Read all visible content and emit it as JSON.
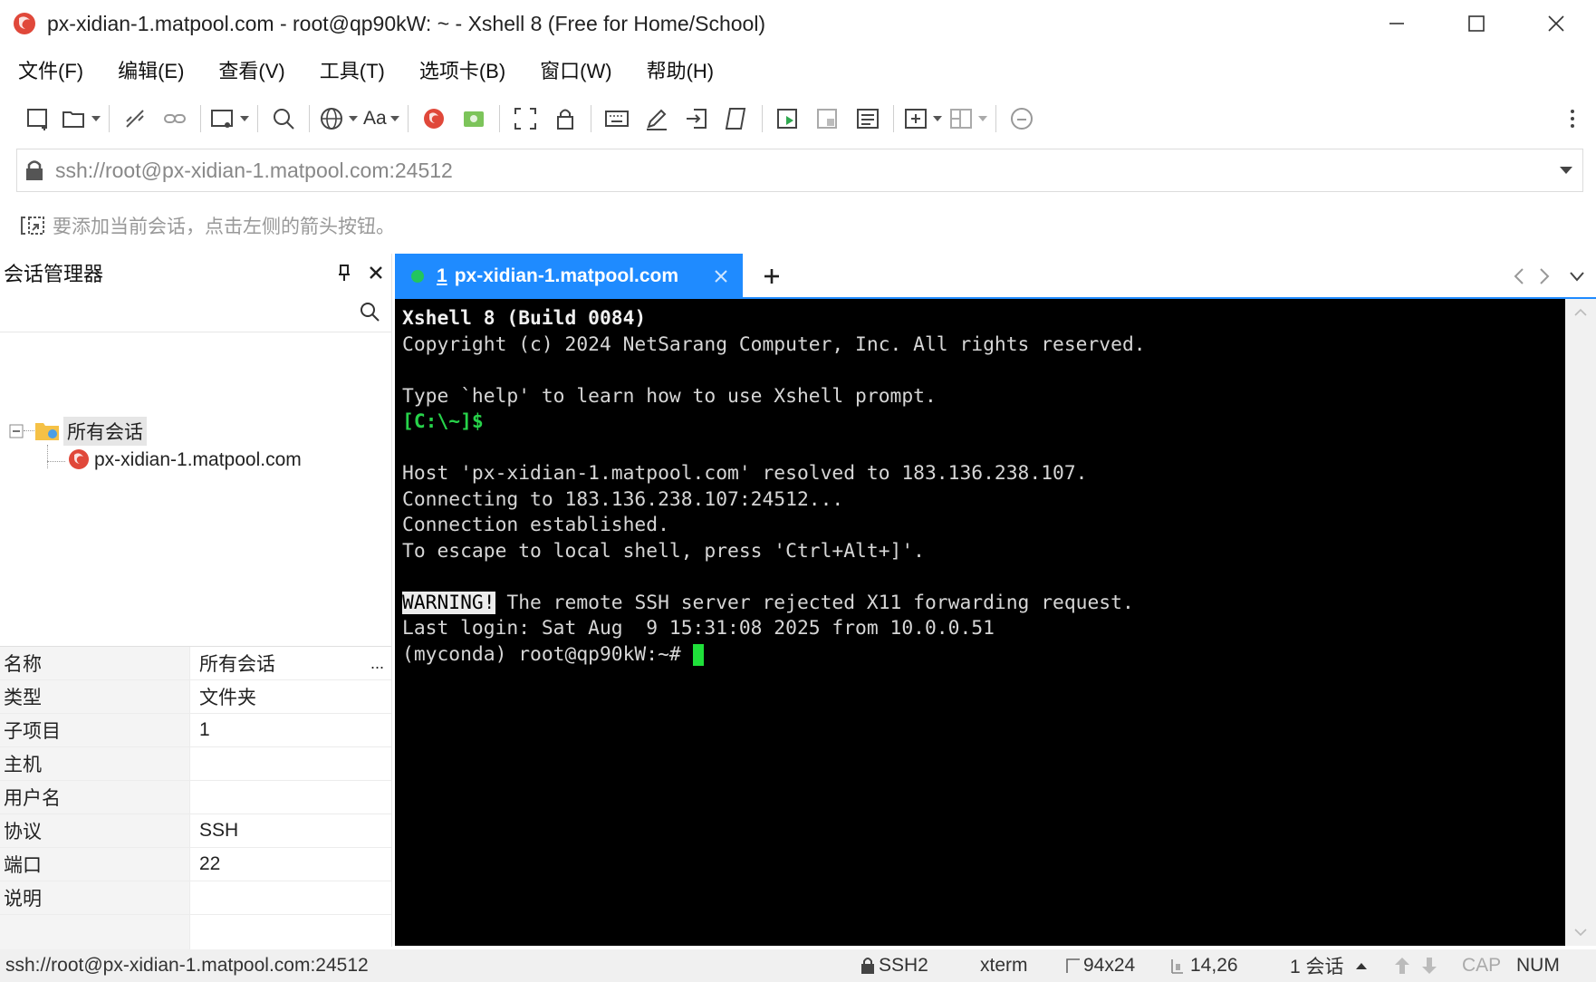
{
  "window": {
    "title": "px-xidian-1.matpool.com - root@qp90kW: ~ - Xshell 8 (Free for Home/School)"
  },
  "menu": [
    "文件(F)",
    "编辑(E)",
    "查看(V)",
    "工具(T)",
    "选项卡(B)",
    "窗口(W)",
    "帮助(H)"
  ],
  "address": {
    "value": "ssh://root@px-xidian-1.matpool.com:24512"
  },
  "hint": {
    "text": "要添加当前会话，点击左侧的箭头按钮。"
  },
  "toolbar": {
    "font_label": "Aa"
  },
  "session_manager": {
    "title": "会话管理器",
    "tree": {
      "root_label": "所有会话",
      "child_label": "px-xidian-1.matpool.com"
    },
    "properties": [
      {
        "key": "名称",
        "value": "所有会话"
      },
      {
        "key": "类型",
        "value": "文件夹"
      },
      {
        "key": "子项目",
        "value": "1"
      },
      {
        "key": "主机",
        "value": ""
      },
      {
        "key": "用户名",
        "value": ""
      },
      {
        "key": "协议",
        "value": "SSH"
      },
      {
        "key": "端口",
        "value": "22"
      },
      {
        "key": "说明",
        "value": ""
      }
    ],
    "more_label": "..."
  },
  "tabs": [
    {
      "number": "1",
      "label": "px-xidian-1.matpool.com",
      "status_color": "#22c55e"
    }
  ],
  "terminal": {
    "lines": [
      {
        "text": "Xshell 8 (Build 0084)",
        "style": "bold"
      },
      {
        "text": "Copyright (c) 2024 NetSarang Computer, Inc. All rights reserved."
      },
      {
        "text": ""
      },
      {
        "text": "Type `help' to learn how to use Xshell prompt."
      },
      {
        "text": "[C:\\~]$",
        "style": "green"
      },
      {
        "text": ""
      },
      {
        "text": "Host 'px-xidian-1.matpool.com' resolved to 183.136.238.107."
      },
      {
        "text": "Connecting to 183.136.238.107:24512..."
      },
      {
        "text": "Connection established."
      },
      {
        "text": "To escape to local shell, press 'Ctrl+Alt+]'."
      },
      {
        "text": ""
      },
      {
        "warning": "WARNING!",
        "text": " The remote SSH server rejected X11 forwarding request."
      },
      {
        "text": "Last login: Sat Aug  9 15:31:08 2025 from 10.0.0.51"
      },
      {
        "text": "(myconda) root@qp90kW:~# ",
        "cursor": true
      }
    ]
  },
  "status": {
    "address": "ssh://root@px-xidian-1.matpool.com:24512",
    "protocol": "SSH2",
    "terminal_type": "xterm",
    "size": "94x24",
    "cursor_pos": "14,26",
    "sessions": "1 会话",
    "cap": "CAP",
    "num": "NUM"
  },
  "colors": {
    "tab_active": "#1f8bff",
    "terminal_bg": "#000000",
    "prompt_green": "#27d24a",
    "cursor_green": "#1fe03a",
    "logo_red": "#e0483a"
  }
}
